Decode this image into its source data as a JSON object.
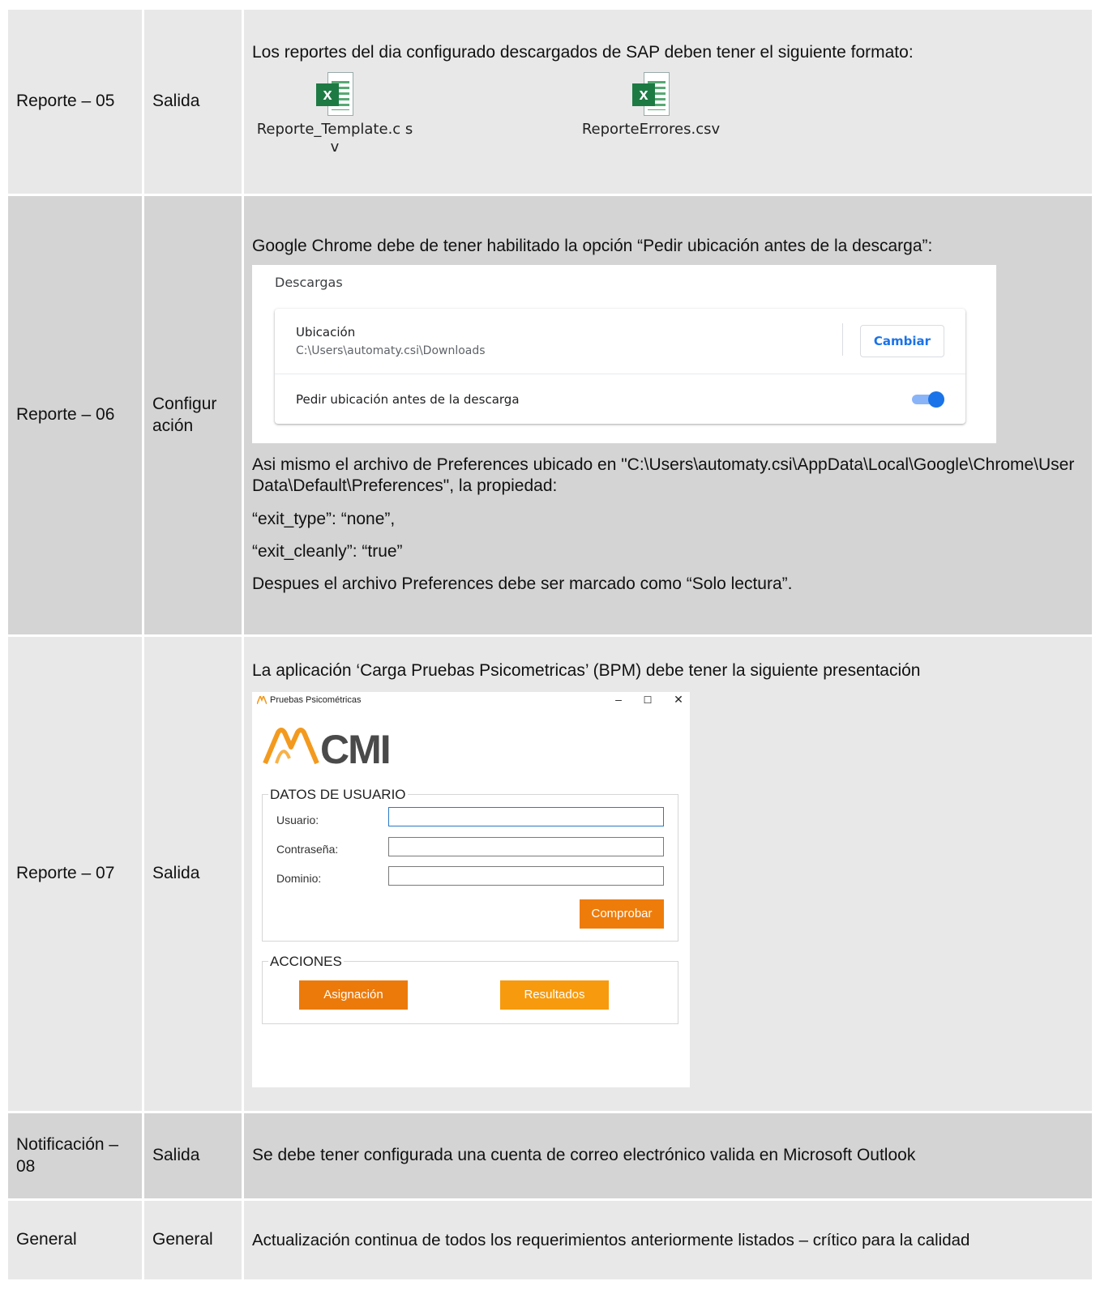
{
  "rows": [
    {
      "id": "Reporte – 05",
      "type": "Salida",
      "text": "Los reportes del dia configurado descargados de SAP deben tener el siguiente formato:",
      "files": [
        {
          "name": "Reporte_Template.c sv"
        },
        {
          "name": "ReporteErrores.csv"
        }
      ]
    },
    {
      "id": "Reporte – 06",
      "type": "Configur ación",
      "text": "Google Chrome debe de tener habilitado la opción “Pedir ubicación antes de la descarga”:",
      "chrome": {
        "header": "Descargas",
        "location_title": "Ubicación",
        "location_path": "C:\\Users\\automaty.csi\\Downloads",
        "change_button": "Cambiar",
        "ask_label": "Pedir ubicación antes de la descarga",
        "ask_enabled": true,
        "accent": "#1a73e8"
      },
      "para1": "Asi mismo el archivo de Preferences ubicado en \"C:\\Users\\automaty.csi\\AppData\\Local\\Google\\Chrome\\User Data\\Default\\Preferences\", la propiedad:",
      "prop1": " “exit_type”: “none”,",
      "prop2": " “exit_cleanly”: “true”",
      "para2": "Despues el archivo Preferences debe ser marcado como “Solo lectura”."
    },
    {
      "id": "Reporte – 07",
      "type": "Salida",
      "text": "La aplicación ‘Carga Pruebas Psicometricas’ (BPM) debe tener la siguiente presentación",
      "app": {
        "window_title": "Pruebas Psicométricas",
        "minimize": "–",
        "maximize": "☐",
        "close": "✕",
        "logo_text": "CMI",
        "section_user": "DATOS DE USUARIO",
        "user_label": "Usuario:",
        "password_label": "Contraseña:",
        "domain_label": "Dominio:",
        "check_button": "Comprobar",
        "section_actions": "ACCIONES",
        "assign_button": "Asignación",
        "results_button": "Resultados",
        "brand_orange": "#ee7c0b"
      }
    },
    {
      "id": "Notificación – 08",
      "type": "Salida",
      "text": "Se debe tener configurada una cuenta de correo electrónico valida en Microsoft Outlook"
    },
    {
      "id": "General",
      "type": "General",
      "text": "Actualización continua de todos los requerimientos anteriormente listados – crítico para la calidad"
    }
  ]
}
